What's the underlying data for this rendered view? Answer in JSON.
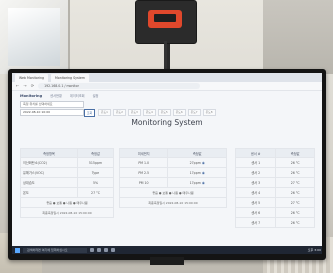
{
  "browser": {
    "tabs": [
      "Web Monitoring",
      "Monitoring System"
    ],
    "url": "192.168.0.1 / monitor"
  },
  "app": {
    "brand": "Monitoring",
    "nav": [
      "센서현황",
      "데이터조회",
      "설정"
    ],
    "select_placeholder": "측정 위치를 선택하세요",
    "date_value": "2022-08-10 10:00",
    "query_button": "조회",
    "chips": [
      "온도1",
      "온도2",
      "온도3",
      "온도4",
      "온도5",
      "온도6",
      "온도7",
      "온도8"
    ],
    "title": "Monitoring System"
  },
  "table1": {
    "headers": [
      "측정항목",
      "측정값"
    ],
    "rows": [
      [
        "이산화탄소(CO2)",
        "515ppm"
      ],
      [
        "유해가스(VOC)",
        "Type"
      ],
      [
        "상대습도",
        "5%"
      ],
      [
        "온도",
        "27 °C"
      ]
    ],
    "footer": "좋음 ● 보통 ● 나쁨 ● 매우나쁨"
  },
  "table2": {
    "headers": [
      "미세먼지",
      "측정값"
    ],
    "rows": [
      [
        "PM 1.0",
        "27ppm"
      ],
      [
        "PM 2.5",
        "17ppm"
      ],
      [
        "PM 10",
        "17ppm"
      ]
    ],
    "footer": "좋음 ● 보통 ● 나쁨 ● 매우나쁨",
    "timestamp": "최종측정일시 2022-08-10 15:00:00"
  },
  "table3": {
    "headers": [
      "센서 #",
      "측정값"
    ],
    "rows": [
      [
        "센서 1",
        "26 °C"
      ],
      [
        "센서 2",
        "26 °C"
      ],
      [
        "센서 3",
        "27 °C"
      ],
      [
        "센서 4",
        "26 °C"
      ],
      [
        "센서 5",
        "27 °C"
      ],
      [
        "센서 6",
        "26 °C"
      ],
      [
        "센서 7",
        "26 °C"
      ]
    ]
  },
  "table1_timestamp": "최종측정일시 2022-08-10 15:00:00",
  "taskbar": {
    "search_placeholder": "검색하려면 여기에 입력하십시오",
    "clock": "오후 3:00"
  }
}
